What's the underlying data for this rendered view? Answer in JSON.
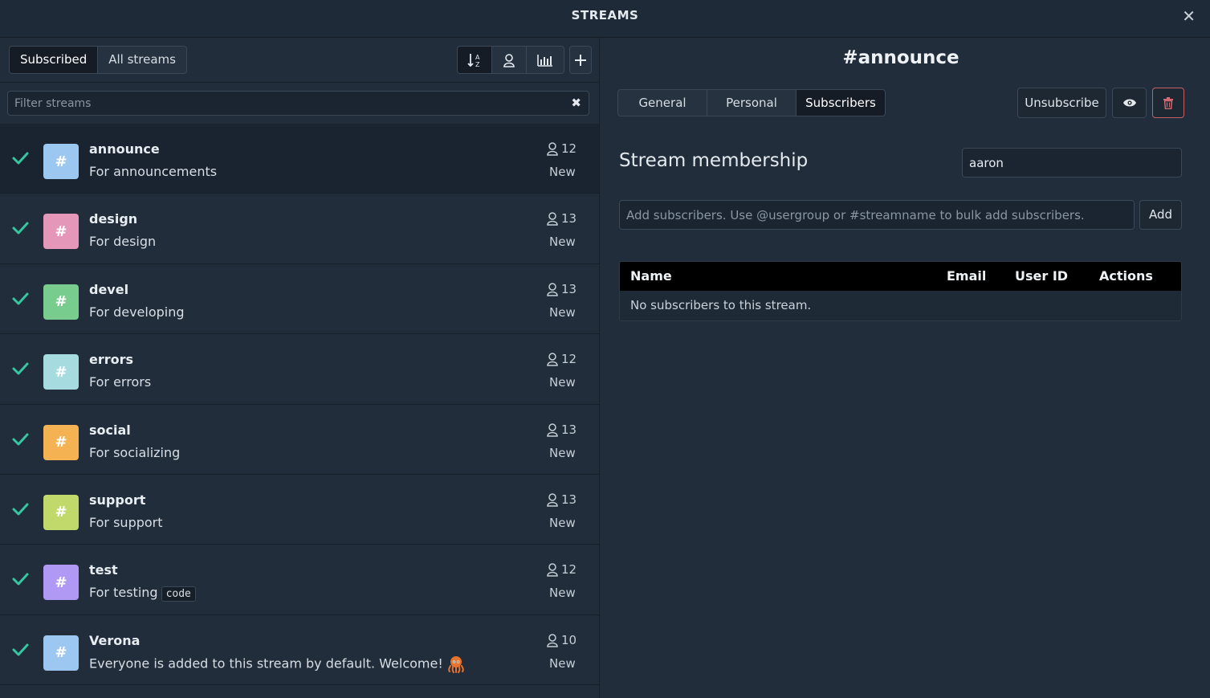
{
  "header": {
    "title": "STREAMS",
    "close_icon": "close-icon"
  },
  "left": {
    "tabs": [
      {
        "label": "Subscribed",
        "active": true
      },
      {
        "label": "All streams",
        "active": false
      }
    ],
    "sort_icons": [
      "sort-alpha-icon",
      "subscribers-icon",
      "activity-chart-icon"
    ],
    "add_icon": "plus-icon",
    "filter": {
      "placeholder": "Filter streams",
      "value": "",
      "clear_icon": "clear-icon"
    },
    "streams": [
      {
        "name": "announce",
        "description": "For announcements",
        "subscribers": "12",
        "status": "New",
        "color": "#9cc7f0",
        "active": true
      },
      {
        "name": "design",
        "description": "For design",
        "subscribers": "13",
        "status": "New",
        "color": "#e597b9"
      },
      {
        "name": "devel",
        "description": "For developing",
        "subscribers": "13",
        "status": "New",
        "color": "#78cc8d"
      },
      {
        "name": "errors",
        "description": "For errors",
        "subscribers": "12",
        "status": "New",
        "color": "#a6dbe0"
      },
      {
        "name": "social",
        "description": "For socializing",
        "subscribers": "13",
        "status": "New",
        "color": "#f5b253"
      },
      {
        "name": "support",
        "description": "For support",
        "subscribers": "13",
        "status": "New",
        "color": "#c1d96a"
      },
      {
        "name": "test",
        "description": "For testing",
        "code": "code",
        "subscribers": "12",
        "status": "New",
        "color": "#b099f5"
      },
      {
        "name": "Verona",
        "description": "Everyone is added to this stream by default. Welcome!",
        "emoji_icon": "octopus-icon",
        "subscribers": "10",
        "status": "New",
        "color": "#9cc7f0"
      }
    ]
  },
  "right": {
    "stream_title": "#announce",
    "tabs": [
      {
        "label": "General",
        "active": false
      },
      {
        "label": "Personal",
        "active": false
      },
      {
        "label": "Subscribers",
        "active": true
      }
    ],
    "unsubscribe_label": "Unsubscribe",
    "eye_icon": "eye-icon",
    "trash_icon": "trash-icon",
    "membership_title": "Stream membership",
    "search_value": "aaron",
    "add_placeholder": "Add subscribers. Use @usergroup or #streamname to bulk add subscribers.",
    "add_label": "Add",
    "table": {
      "columns": [
        "Name",
        "Email",
        "User ID",
        "Actions"
      ],
      "empty_message": "No subscribers to this stream."
    }
  },
  "colors": {
    "accent_check": "#36c7a0",
    "danger": "#c4606a"
  }
}
